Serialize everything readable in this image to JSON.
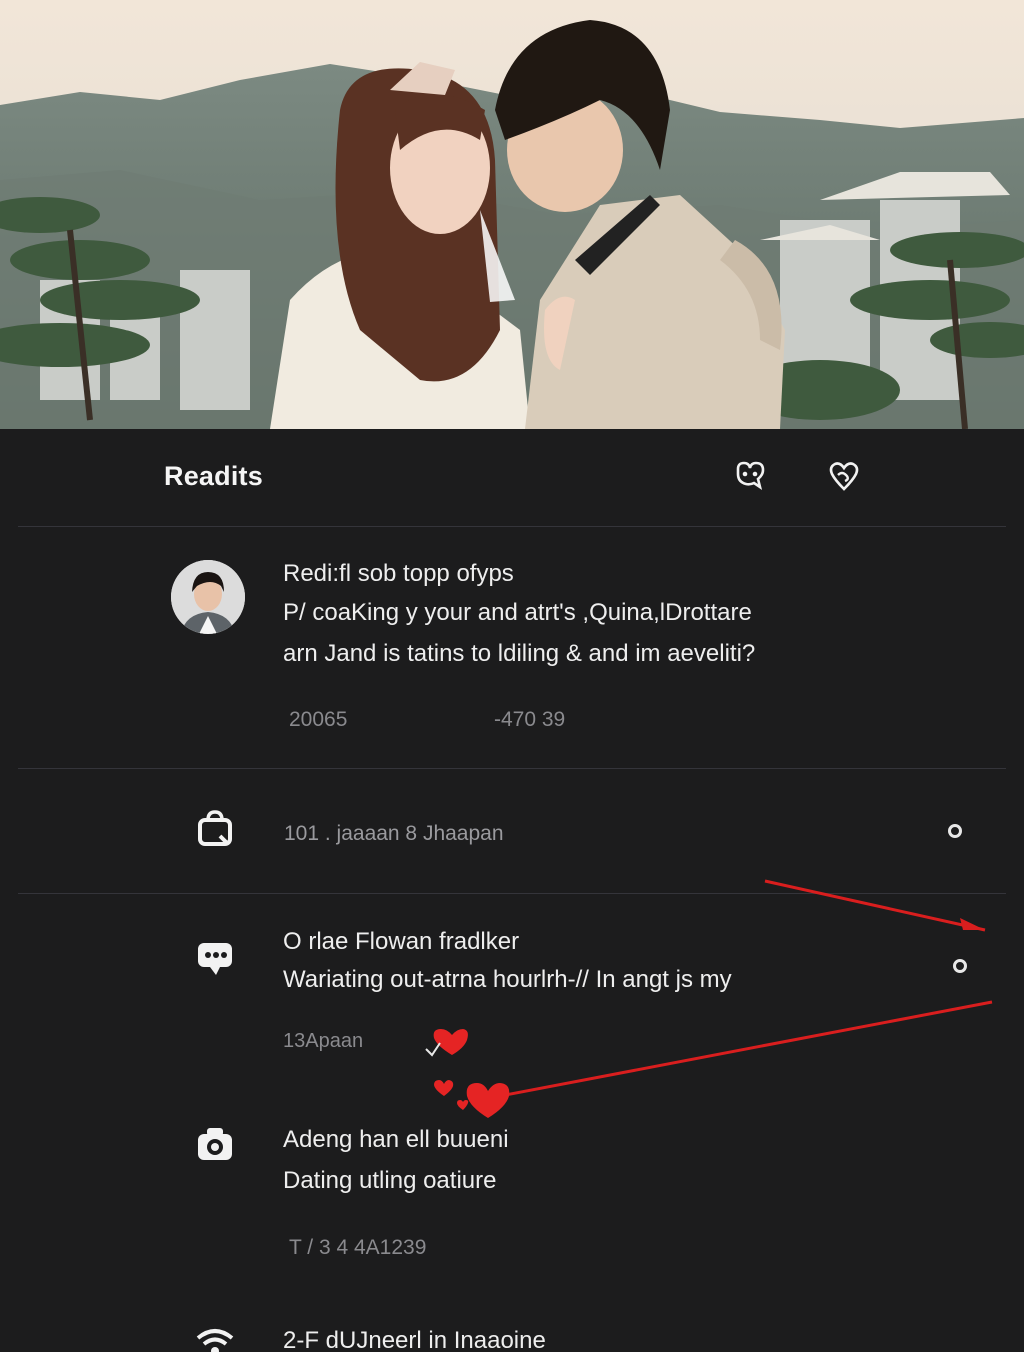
{
  "header": {
    "title": "Readits",
    "icons": [
      "heart-chat-icon",
      "heart-swirl-icon"
    ]
  },
  "post": {
    "title": "Redi:fl sob topp ofyps",
    "body_line1": "P/ coaKing y your and atrt's ,Quina,lDrottare",
    "body_line2": "arn Jand is tatins to ldiling & and im aeveliti?",
    "stat_left": "20065",
    "stat_right": "-470 39"
  },
  "items": [
    {
      "icon": "shopping-bag-icon",
      "text": "101 . jaaaan 8 Jhaapan"
    },
    {
      "icon": "chat-bubble-icon",
      "title": "O rlae Flowan fradlker",
      "body": "Wariating out-atrna hourlrh-// In angt js my",
      "meta": "13Apaan"
    },
    {
      "icon": "camera-icon",
      "title": "Adeng han ell buueni",
      "body": "Dating utling oatiure",
      "meta": "T / 3 4 4A1239"
    },
    {
      "icon": "wifi-icon",
      "text": "2-F dUJneerl in Inaaoine"
    }
  ],
  "colors": {
    "background": "#1c1c1d",
    "divider": "#34343a",
    "accent_red": "#d91e1e",
    "text": "#eeeeee",
    "muted": "#8a8a8e"
  }
}
